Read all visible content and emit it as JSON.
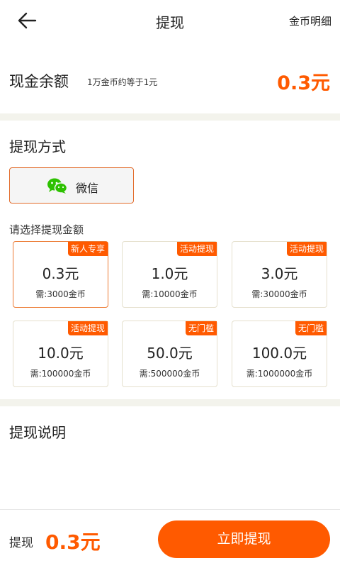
{
  "header": {
    "title": "提现",
    "detail_link": "金币明细"
  },
  "balance": {
    "label": "现金余额",
    "note": "1万金币约等于1元",
    "value": "0.3元"
  },
  "method": {
    "title": "提现方式",
    "wechat_label": "微信"
  },
  "amounts": {
    "hint": "请选择提现金额",
    "selected_index": 0,
    "items": [
      {
        "tag": "新人专享",
        "amount": "0.3元",
        "need": "需:3000金币"
      },
      {
        "tag": "活动提现",
        "amount": "1.0元",
        "need": "需:10000金币"
      },
      {
        "tag": "活动提现",
        "amount": "3.0元",
        "need": "需:30000金币"
      },
      {
        "tag": "活动提现",
        "amount": "10.0元",
        "need": "需:100000金币"
      },
      {
        "tag": "无门槛",
        "amount": "50.0元",
        "need": "需:500000金币"
      },
      {
        "tag": "无门槛",
        "amount": "100.0元",
        "need": "需:1000000金币"
      }
    ]
  },
  "explain": {
    "title": "提现说明"
  },
  "bottom": {
    "label": "提现",
    "amount": "0.3元",
    "button": "立即提现"
  },
  "colors": {
    "accent": "#ff5a00",
    "card_border": "#e5e0cd",
    "wechat_green": "#2dc100"
  },
  "icons": [
    "arrow-left-icon",
    "wechat-icon"
  ]
}
